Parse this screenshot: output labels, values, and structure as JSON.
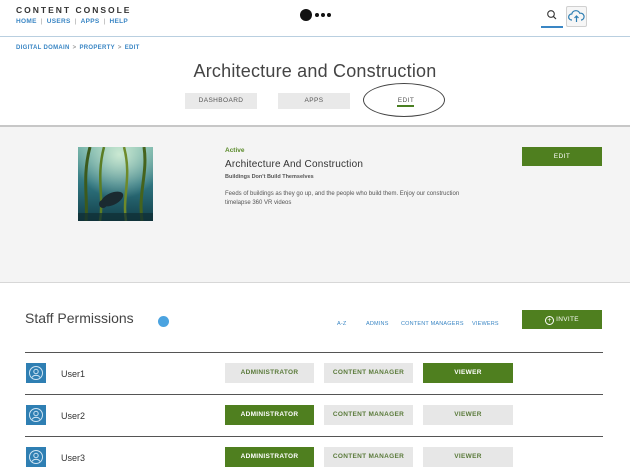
{
  "header": {
    "brand": "CONTENT CONSOLE",
    "nav": [
      "HOME",
      "USERS",
      "APPS",
      "HELP"
    ]
  },
  "breadcrumb": [
    "DIGITAL DOMAIN",
    "PROPERTY",
    "EDIT"
  ],
  "page_title": "Architecture and Construction",
  "tabs": [
    {
      "label": "DASHBOARD",
      "active": false
    },
    {
      "label": "APPS",
      "active": false
    },
    {
      "label": "EDIT",
      "active": true
    }
  ],
  "app": {
    "status": "Active",
    "name": "Architecture And Construction",
    "tagline": "Buildings Don't Build Themselves",
    "description": "Feeds of buildings as they go up, and the people who build them. Enjoy our construction timelapse 360 VR videos",
    "edit_label": "EDIT"
  },
  "staff": {
    "title": "Staff Permissions",
    "filters": [
      "A-Z",
      "ADMINS",
      "CONTENT MANAGERS",
      "VIEWERS"
    ],
    "invite_label": "INVITE",
    "roles": [
      "ADMINISTRATOR",
      "CONTENT MANAGER",
      "VIEWER"
    ],
    "users": [
      {
        "name": "User1",
        "role": "VIEWER"
      },
      {
        "name": "User2",
        "role": "ADMINISTRATOR"
      },
      {
        "name": "User3",
        "role": "ADMINISTRATOR"
      }
    ]
  },
  "colors": {
    "accent_green": "#4f7f1f",
    "link_blue": "#3a86c4",
    "avatar_blue": "#2f7fb3"
  },
  "icons": [
    "search-icon",
    "cloud-upload-icon",
    "user-icon",
    "plus-circle-icon",
    "info-icon"
  ]
}
